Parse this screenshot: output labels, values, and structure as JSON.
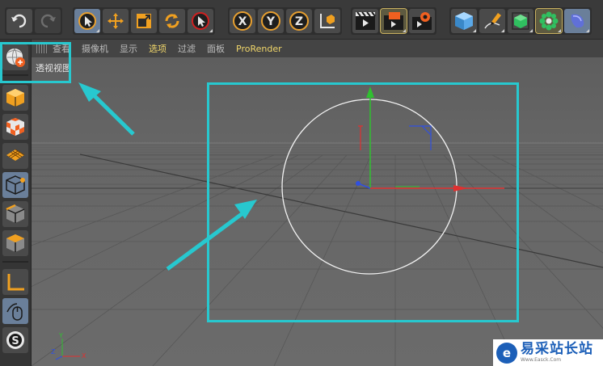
{
  "toolbar": {
    "groups": [
      {
        "name": "undo-redo",
        "icons": [
          "undo-icon",
          "redo-icon"
        ]
      },
      {
        "name": "tools",
        "icons": [
          "select-arrow-icon",
          "move-icon",
          "scale-icon",
          "rotate-icon",
          "live-select-icon"
        ]
      },
      {
        "name": "axis-lock",
        "icons": [
          "x-axis-icon",
          "y-axis-icon",
          "z-axis-icon",
          "world-coordinates-icon"
        ]
      },
      {
        "name": "render",
        "icons": [
          "render-view-icon",
          "render-picture-viewer-icon",
          "render-settings-icon"
        ]
      },
      {
        "name": "objects",
        "icons": [
          "cube-icon",
          "pen-spline-icon",
          "subdivision-icon",
          "cloner-icon",
          "deformer-icon"
        ]
      }
    ],
    "axis_labels": {
      "x": "X",
      "y": "Y",
      "z": "Z"
    }
  },
  "viewport_menu": {
    "items": [
      "查看",
      "摄像机",
      "显示",
      "选项",
      "过滤",
      "面板",
      "ProRender"
    ],
    "highlighted": "选项"
  },
  "viewport": {
    "label": "透视视图",
    "axis_gizmo": {
      "x": "X",
      "y": "Y",
      "z": "Z"
    }
  },
  "palette": {
    "icons": [
      "perspective-view-icon",
      "model-mode-icon",
      "texture-mode-icon",
      "workplane-mode-icon",
      "points-mode-icon",
      "edges-mode-icon",
      "polygons-mode-icon",
      "axis-mode-icon",
      "tweak-mode-icon",
      "snap-icon"
    ]
  },
  "watermark": {
    "title": "易采站长站",
    "subtitle": "Www.Easck.Com"
  },
  "colors": {
    "highlight": "#27c8cf",
    "menu_highlight": "#f0d66a",
    "axis_x": "#e03030",
    "axis_y": "#30c030",
    "axis_z": "#3050e0"
  }
}
